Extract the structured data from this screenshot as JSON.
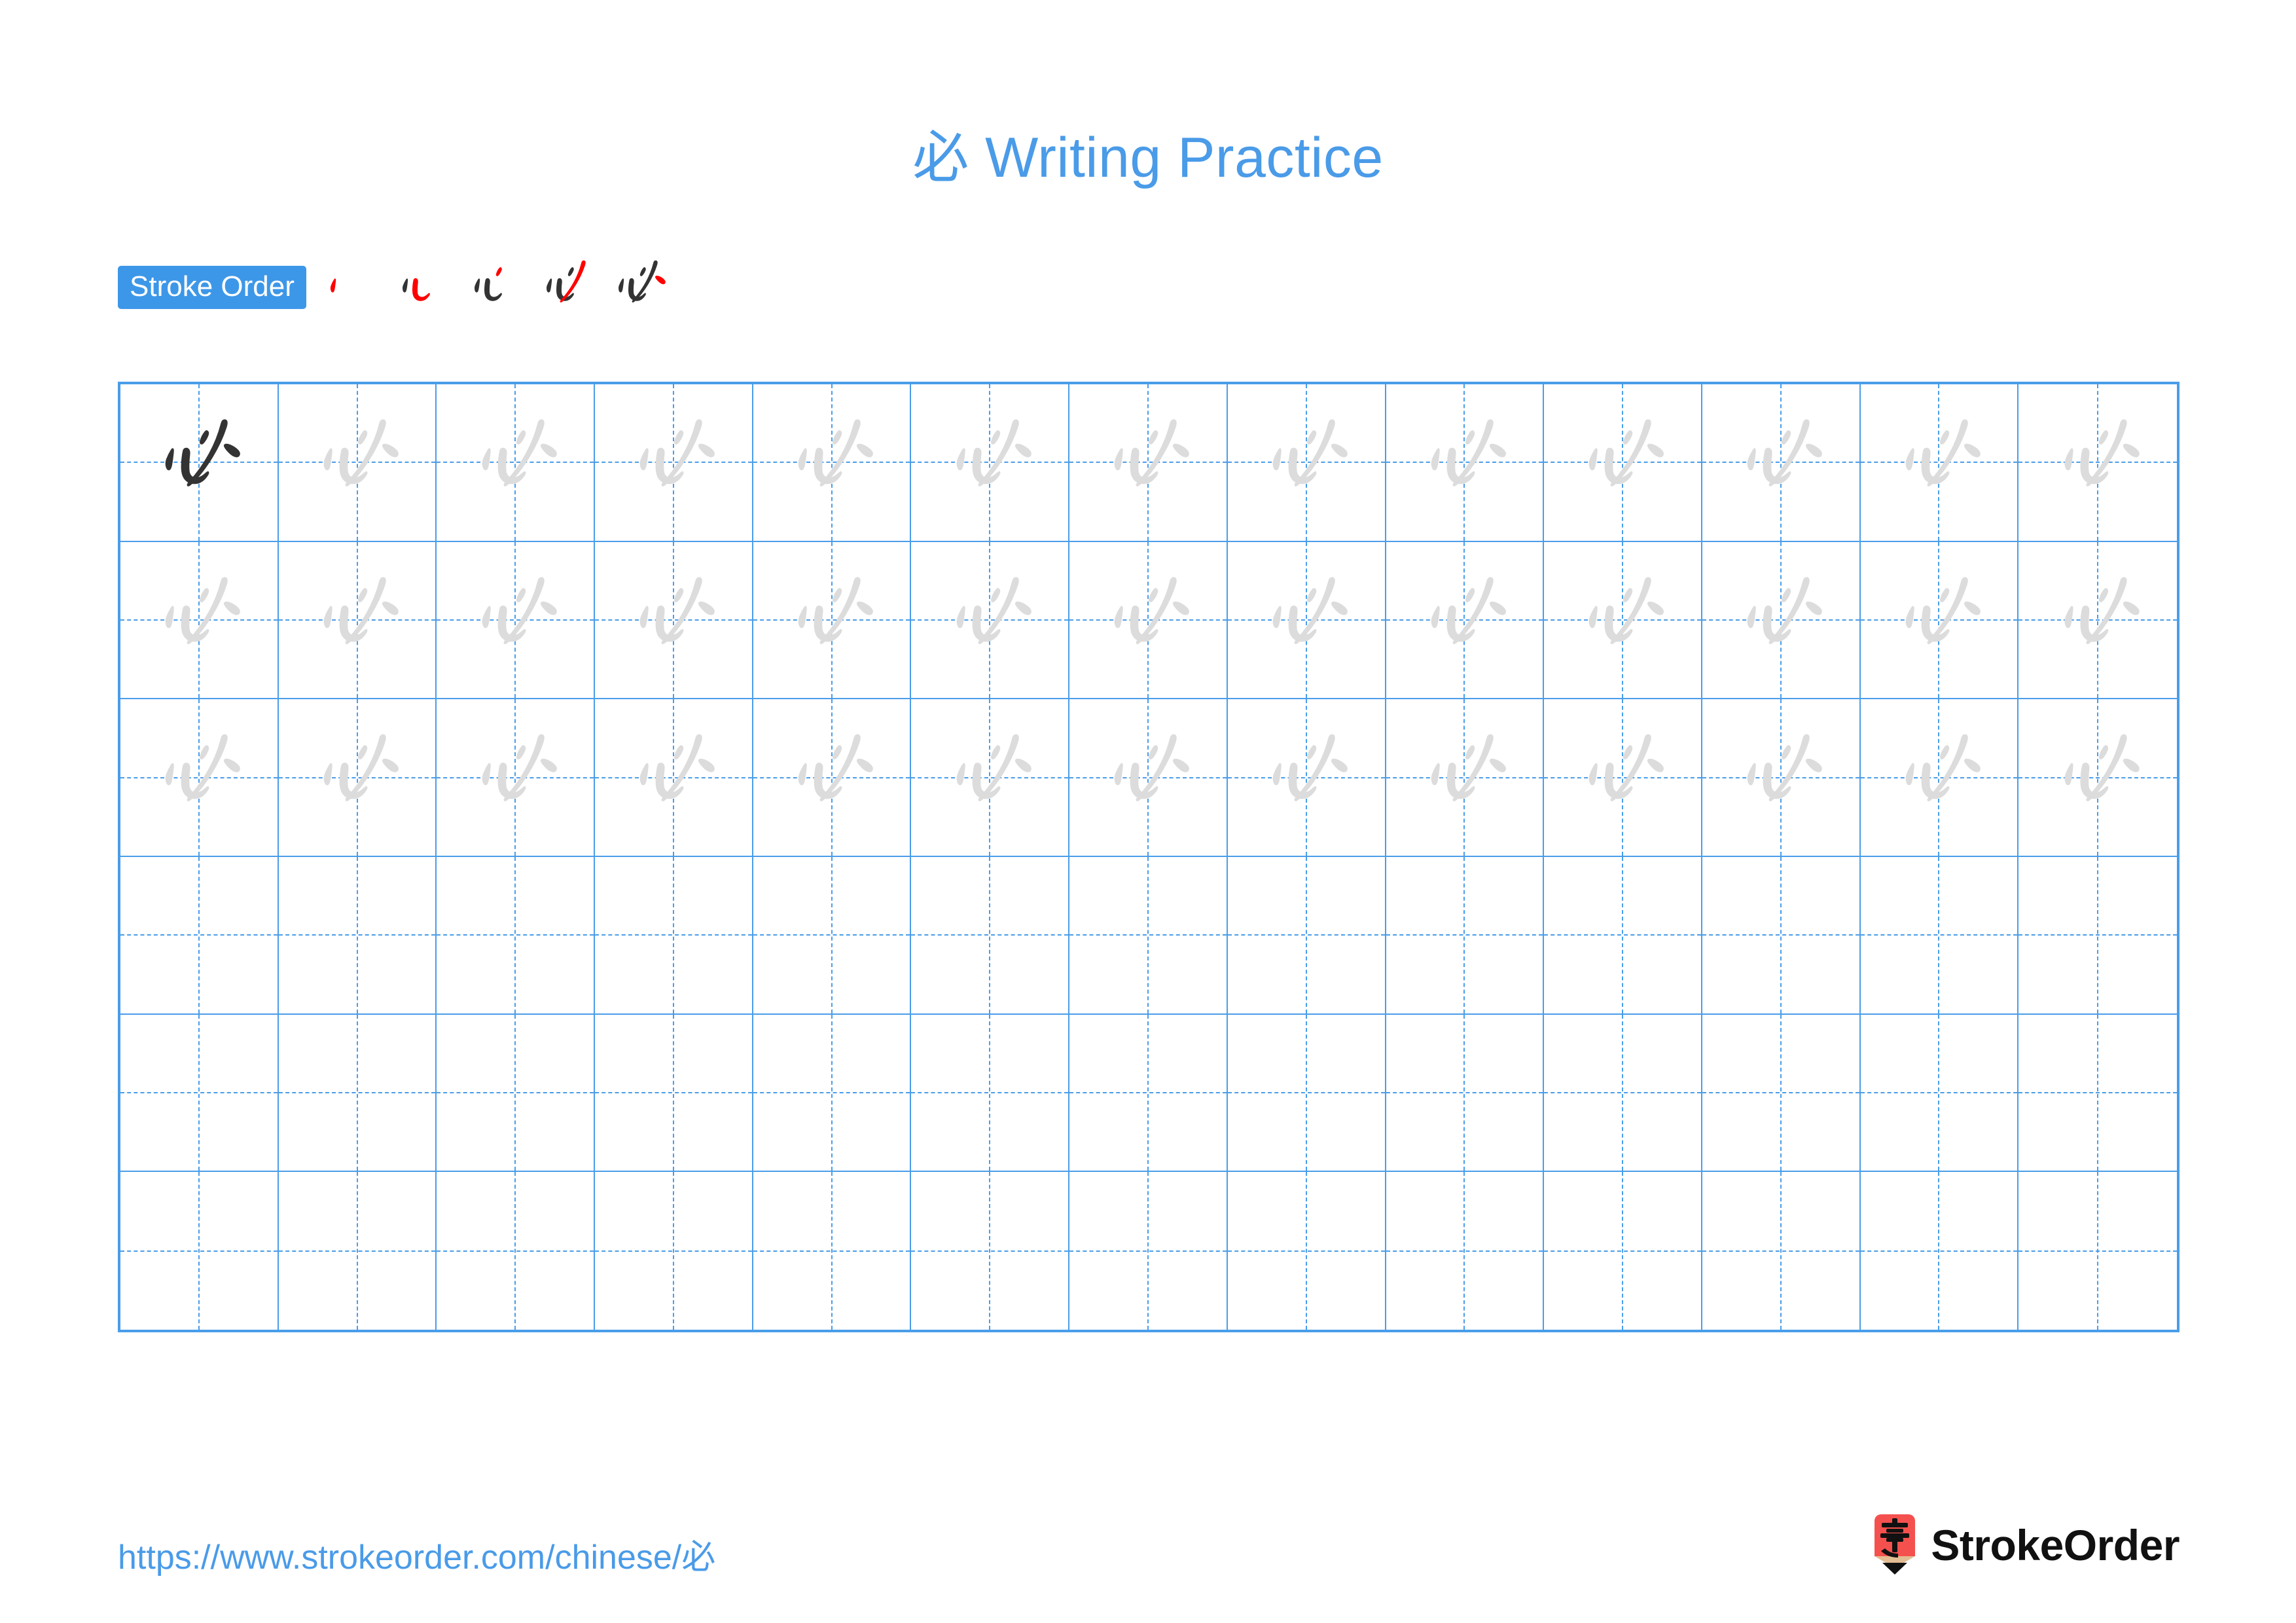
{
  "page": {
    "character": "必",
    "background_color": "#ffffff"
  },
  "header": {
    "title": "必 Writing Practice",
    "title_color": "#4a9be8"
  },
  "stroke_order": {
    "badge_label": "Stroke Order",
    "badge_bg_color": "#3d97e8",
    "badge_text_color": "#ffffff",
    "stroke_count": 5,
    "new_stroke_color": "#ff0000",
    "done_stroke_color": "#333333",
    "steps": [
      {
        "step": 1,
        "strokes_shown": 1,
        "new_stroke": "dot-left-center"
      },
      {
        "step": 2,
        "strokes_shown": 2,
        "new_stroke": "horizontal-hook"
      },
      {
        "step": 3,
        "strokes_shown": 3,
        "new_stroke": "dot-upper-left"
      },
      {
        "step": 4,
        "strokes_shown": 4,
        "new_stroke": "diagonal-sweep"
      },
      {
        "step": 5,
        "strokes_shown": 5,
        "new_stroke": "dot-upper-right"
      }
    ]
  },
  "practice_grid": {
    "columns": 13,
    "rows": 6,
    "border_color": "#4a9de9",
    "guide_color": "#4a9de9",
    "model_char_color": "#333333",
    "trace_char_color": "#dcdcdc",
    "cells": [
      [
        "model",
        "trace",
        "trace",
        "trace",
        "trace",
        "trace",
        "trace",
        "trace",
        "trace",
        "trace",
        "trace",
        "trace",
        "trace"
      ],
      [
        "trace",
        "trace",
        "trace",
        "trace",
        "trace",
        "trace",
        "trace",
        "trace",
        "trace",
        "trace",
        "trace",
        "trace",
        "trace"
      ],
      [
        "trace",
        "trace",
        "trace",
        "trace",
        "trace",
        "trace",
        "trace",
        "trace",
        "trace",
        "trace",
        "trace",
        "trace",
        "trace"
      ],
      [
        "empty",
        "empty",
        "empty",
        "empty",
        "empty",
        "empty",
        "empty",
        "empty",
        "empty",
        "empty",
        "empty",
        "empty",
        "empty"
      ],
      [
        "empty",
        "empty",
        "empty",
        "empty",
        "empty",
        "empty",
        "empty",
        "empty",
        "empty",
        "empty",
        "empty",
        "empty",
        "empty"
      ],
      [
        "empty",
        "empty",
        "empty",
        "empty",
        "empty",
        "empty",
        "empty",
        "empty",
        "empty",
        "empty",
        "empty",
        "empty",
        "empty"
      ]
    ]
  },
  "footer": {
    "url": "https://www.strokeorder.com/chinese/必",
    "url_color": "#4a9be8",
    "brand_name": "StrokeOrder",
    "brand_mark_char": "字",
    "brand_mark_color": "#f4514e",
    "brand_mark_wood_color": "#e3bd93",
    "brand_mark_tip_color": "#111111"
  }
}
